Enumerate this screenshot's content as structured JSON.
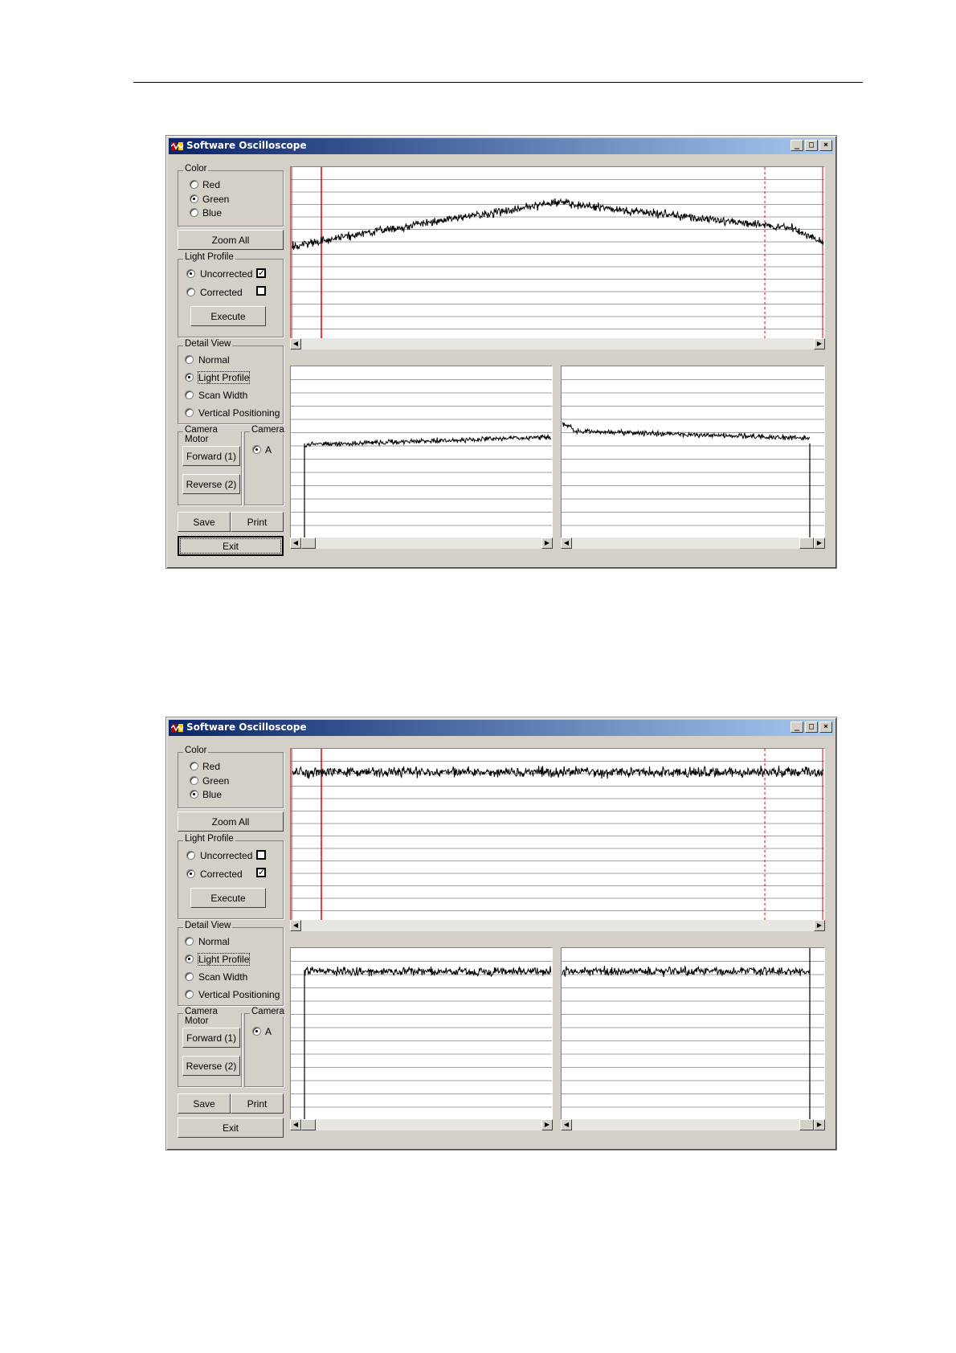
{
  "windows": [
    {
      "title": "Software Oscilloscope",
      "color_group": {
        "title": "Color",
        "options": [
          "Red",
          "Green",
          "Blue"
        ],
        "selected": "Green"
      },
      "zoom_all": "Zoom All",
      "light_profile": {
        "title": "Light Profile",
        "uncorrected": {
          "label": "Uncorrected",
          "selected": true,
          "checked": true
        },
        "corrected": {
          "label": "Corrected",
          "selected": false,
          "checked": false
        },
        "execute": "Execute"
      },
      "detail_view": {
        "title": "Detail View",
        "options": [
          "Normal",
          "Light Profile",
          "Scan Width",
          "Vertical Positioning"
        ],
        "selected": "Light Profile"
      },
      "camera_motor": {
        "title": "Camera Motor",
        "forward": "Forward (1)",
        "reverse": "Reverse (2)"
      },
      "camera": {
        "title": "Camera",
        "options": [
          "A"
        ],
        "selected": "A"
      },
      "save": "Save",
      "print": "Print",
      "exit": "Exit",
      "exit_focused": true,
      "signal": "curved"
    },
    {
      "title": "Software Oscilloscope",
      "color_group": {
        "title": "Color",
        "options": [
          "Red",
          "Green",
          "Blue"
        ],
        "selected": "Blue"
      },
      "zoom_all": "Zoom All",
      "light_profile": {
        "title": "Light Profile",
        "uncorrected": {
          "label": "Uncorrected",
          "selected": false,
          "checked": false
        },
        "corrected": {
          "label": "Corrected",
          "selected": true,
          "checked": true
        },
        "execute": "Execute"
      },
      "detail_view": {
        "title": "Detail View",
        "options": [
          "Normal",
          "Light Profile",
          "Scan Width",
          "Vertical Positioning"
        ],
        "selected": "Light Profile"
      },
      "camera_motor": {
        "title": "Camera Motor",
        "forward": "Forward (1)",
        "reverse": "Reverse (2)"
      },
      "camera": {
        "title": "Camera",
        "options": [
          "A"
        ],
        "selected": "A"
      },
      "save": "Save",
      "print": "Print",
      "exit": "Exit",
      "exit_focused": false,
      "signal": "flat"
    }
  ],
  "colors": {
    "title_start": "#0a246a",
    "title_end": "#a6caf0",
    "marker": "#e00000",
    "face": "#d4d0c8"
  },
  "icons": [
    "app-icon",
    "minimize-icon",
    "maximize-icon",
    "close-icon",
    "scroll-left-icon",
    "scroll-right-icon"
  ]
}
